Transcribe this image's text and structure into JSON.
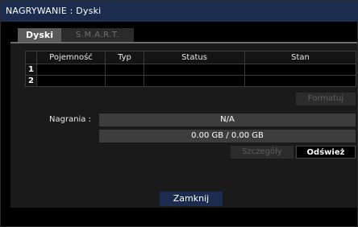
{
  "window": {
    "title": "NAGRYWANIE : Dyski"
  },
  "tabs": [
    {
      "label": "Dyski",
      "active": true
    },
    {
      "label": "S.M.A.R.T.",
      "active": false
    }
  ],
  "disk_table": {
    "columns": [
      "Pojemność",
      "Typ",
      "Status",
      "Stan"
    ],
    "rows": [
      {
        "index": "1",
        "cells": [
          "",
          "",
          "",
          ""
        ]
      },
      {
        "index": "2",
        "cells": [
          "",
          "",
          "",
          ""
        ]
      }
    ]
  },
  "buttons": {
    "format": "Formatuj",
    "details": "Szczegóły",
    "refresh": "Odśwież",
    "close": "Zamknij"
  },
  "recordings": {
    "label": "Nagrania :",
    "status": "N/A",
    "usage": "0.00 GB / 0.00 GB"
  },
  "colors": {
    "title_bar": "#1c2c4e",
    "active_tab": "#5a5a5a",
    "disabled_button": "#2c2c2c",
    "value_bar": "#3d3d3d"
  }
}
